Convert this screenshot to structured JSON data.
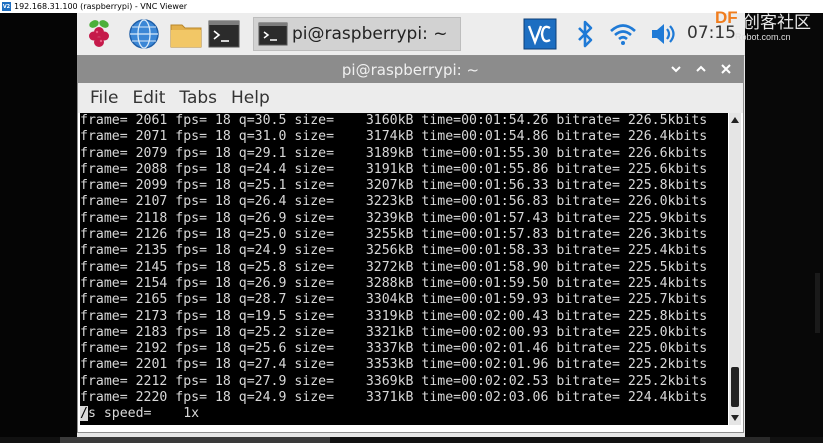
{
  "vnc_window": {
    "title": "192.168.31.100 (raspberrypi) - VNC Viewer",
    "logo_text": "V2"
  },
  "taskbar": {
    "task_title": "pi@raspberrypi: ~",
    "clock": "07:15"
  },
  "watermark": {
    "brand": "DF",
    "brand_cn": "创客社区",
    "url": "Robot.com.cn"
  },
  "terminal": {
    "title": "pi@raspberrypi: ~",
    "menu": [
      "File",
      "Edit",
      "Tabs",
      "Help"
    ],
    "lines": [
      "frame= 2061 fps= 18 q=30.5 size=    3160kB time=00:01:54.26 bitrate= 226.5kbits",
      "frame= 2071 fps= 18 q=31.0 size=    3174kB time=00:01:54.86 bitrate= 226.4kbits",
      "frame= 2079 fps= 18 q=29.1 size=    3189kB time=00:01:55.30 bitrate= 226.6kbits",
      "frame= 2088 fps= 18 q=24.4 size=    3191kB time=00:01:55.86 bitrate= 225.6kbits",
      "frame= 2099 fps= 18 q=25.1 size=    3207kB time=00:01:56.33 bitrate= 225.8kbits",
      "frame= 2107 fps= 18 q=26.4 size=    3223kB time=00:01:56.83 bitrate= 226.0kbits",
      "frame= 2118 fps= 18 q=26.9 size=    3239kB time=00:01:57.43 bitrate= 225.9kbits",
      "frame= 2126 fps= 18 q=25.0 size=    3255kB time=00:01:57.83 bitrate= 226.3kbits",
      "frame= 2135 fps= 18 q=24.9 size=    3256kB time=00:01:58.33 bitrate= 225.4kbits",
      "frame= 2145 fps= 18 q=25.8 size=    3272kB time=00:01:58.90 bitrate= 225.5kbits",
      "frame= 2154 fps= 18 q=26.9 size=    3288kB time=00:01:59.50 bitrate= 225.4kbits",
      "frame= 2165 fps= 18 q=28.7 size=    3304kB time=00:01:59.93 bitrate= 225.7kbits",
      "frame= 2173 fps= 18 q=19.5 size=    3319kB time=00:02:00.43 bitrate= 225.8kbits",
      "frame= 2183 fps= 18 q=25.2 size=    3321kB time=00:02:00.93 bitrate= 225.0kbits",
      "frame= 2192 fps= 18 q=25.6 size=    3337kB time=00:02:01.46 bitrate= 225.0kbits",
      "frame= 2201 fps= 18 q=27.4 size=    3353kB time=00:02:01.96 bitrate= 225.2kbits",
      "frame= 2212 fps= 18 q=27.9 size=    3369kB time=00:02:02.53 bitrate= 225.2kbits",
      "frame= 2220 fps= 18 q=24.9 size=    3371kB time=00:02:03.06 bitrate= 224.4kbits"
    ],
    "cursor_char": "/",
    "cursor_line_rest": "s speed=    1x"
  },
  "colors": {
    "terminal_bg": "#000000",
    "terminal_fg": "#d8d8d8",
    "titlebar": "#8c8c8c",
    "taskbar": "#ededed",
    "vnc_blue": "#1d6ec1",
    "accent_orange": "#f07d1e"
  },
  "icons": {
    "rpi_menu": "raspberry-icon",
    "browser": "globe-icon",
    "files": "folder-icon",
    "terminal": "terminal-icon",
    "vnc": "vnc-icon",
    "bluetooth": "bluetooth-icon",
    "wifi": "wifi-icon",
    "volume": "speaker-icon"
  }
}
